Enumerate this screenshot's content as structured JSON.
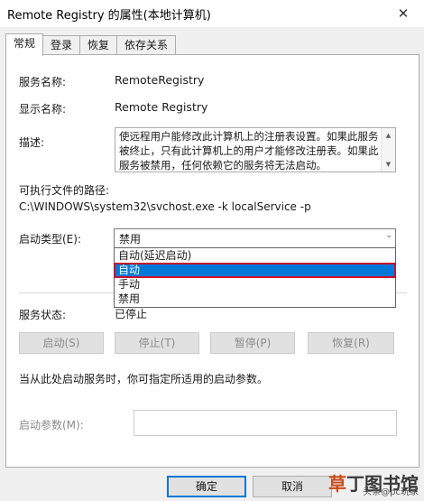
{
  "window": {
    "title": "Remote Registry 的属性(本地计算机)"
  },
  "tabs": [
    "常规",
    "登录",
    "恢复",
    "依存关系"
  ],
  "general": {
    "service_name_label": "服务名称:",
    "service_name": "RemoteRegistry",
    "display_name_label": "显示名称:",
    "display_name": "Remote Registry",
    "description_label": "描述:",
    "description": "使远程用户能修改此计算机上的注册表设置。如果此服务被终止，只有此计算机上的用户才能修改注册表。如果此服务被禁用，任何依赖它的服务将无法启动。",
    "exe_path_label": "可执行文件的路径:",
    "exe_path": "C:\\WINDOWS\\system32\\svchost.exe -k localService -p",
    "startup_type_label": "启动类型(E):",
    "startup_type_value": "禁用",
    "startup_options": [
      "自动(延迟启动)",
      "自动",
      "手动",
      "禁用"
    ],
    "status_label": "服务状态:",
    "status_value": "已停止",
    "buttons": {
      "start": "启动(S)",
      "stop": "停止(T)",
      "pause": "暂停(P)",
      "resume": "恢复(R)"
    },
    "hint": "当从此处启动服务时，你可指定所适用的启动参数。",
    "param_label": "启动参数(M):"
  },
  "footer": {
    "ok": "确定",
    "cancel": "取消"
  },
  "watermark": {
    "logo_1": "草",
    "logo_2": "丁",
    "logo_3": "图书馆",
    "sub": "头条@pc玩家"
  },
  "colors": {
    "accent": "#0078d7",
    "highlight_border": "#c4122f"
  }
}
